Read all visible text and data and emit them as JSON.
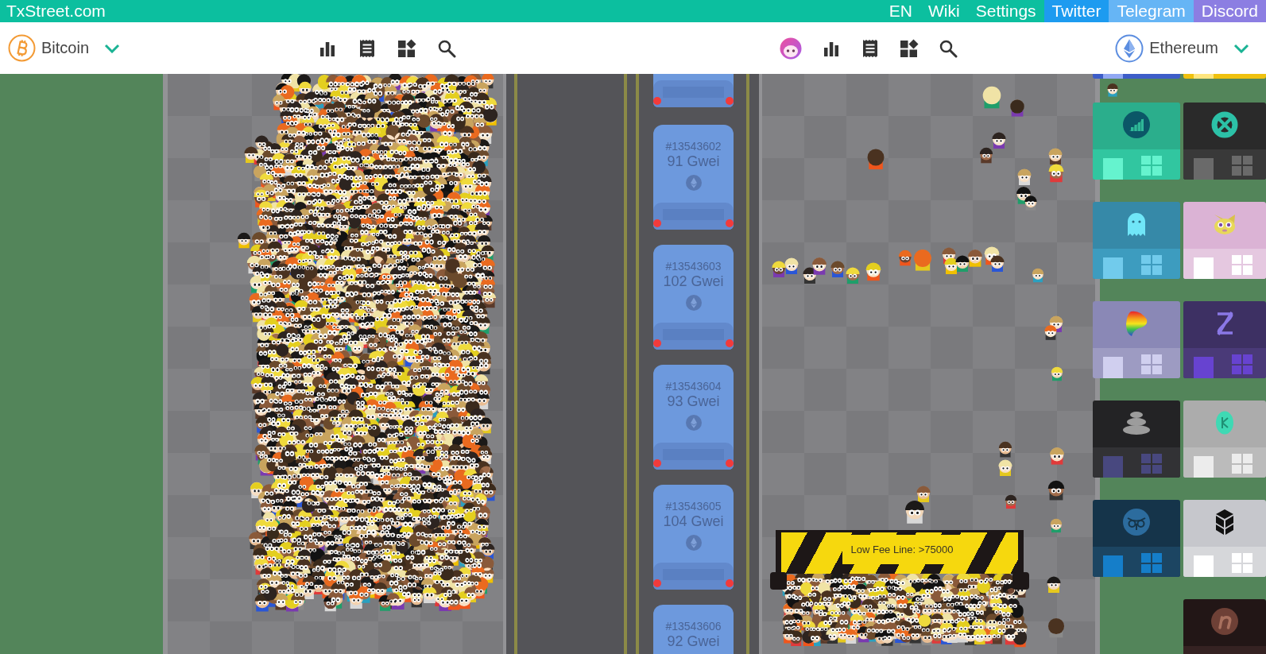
{
  "top_bar": {
    "site_title": "TxStreet.com",
    "links": [
      {
        "label": "EN",
        "kind": "plain"
      },
      {
        "label": "Wiki",
        "kind": "plain"
      },
      {
        "label": "Settings",
        "kind": "plain"
      },
      {
        "label": "Twitter",
        "kind": "social",
        "color": "#1d9bf0"
      },
      {
        "label": "Telegram",
        "kind": "social",
        "color": "#66b5f5"
      },
      {
        "label": "Discord",
        "kind": "social",
        "color": "#8c7ee2"
      }
    ]
  },
  "left_chain": {
    "name": "Bitcoin"
  },
  "right_chain": {
    "name": "Ethereum"
  },
  "ethereum_street": {
    "buses": [
      {
        "kind": "tail"
      },
      {
        "kind": "full",
        "block": "#13543602",
        "fee": "91 Gwei"
      },
      {
        "kind": "full",
        "block": "#13543603",
        "fee": "102 Gwei"
      },
      {
        "kind": "full",
        "block": "#13543604",
        "fee": "93 Gwei"
      },
      {
        "kind": "full",
        "block": "#13543605",
        "fee": "104 Gwei"
      },
      {
        "kind": "cut",
        "block": "#13543606",
        "fee": "92 Gwei"
      }
    ],
    "fee_line": {
      "label": "Low Fee Line: >75000"
    },
    "building_columns": [
      [
        {
          "kind": "edge",
          "color": "#3d5dc8"
        },
        {
          "kind": "full",
          "color": "#2bae8c"
        },
        {
          "kind": "full",
          "color": "#3689a8"
        },
        {
          "kind": "full",
          "color": "#8a88b6"
        },
        {
          "kind": "full",
          "color": "#232325"
        },
        {
          "kind": "full",
          "color": "#15344a"
        }
      ],
      [
        {
          "kind": "edge",
          "color": "#efc10f"
        },
        {
          "kind": "full",
          "color": "#2a2a2a"
        },
        {
          "kind": "full",
          "color": "#dbb3d5"
        },
        {
          "kind": "full",
          "color": "#3d3063"
        },
        {
          "kind": "full",
          "color": "#acacac"
        },
        {
          "kind": "full",
          "color": "#c6c7cc"
        },
        {
          "kind": "top",
          "color": "#221616"
        }
      ]
    ]
  }
}
